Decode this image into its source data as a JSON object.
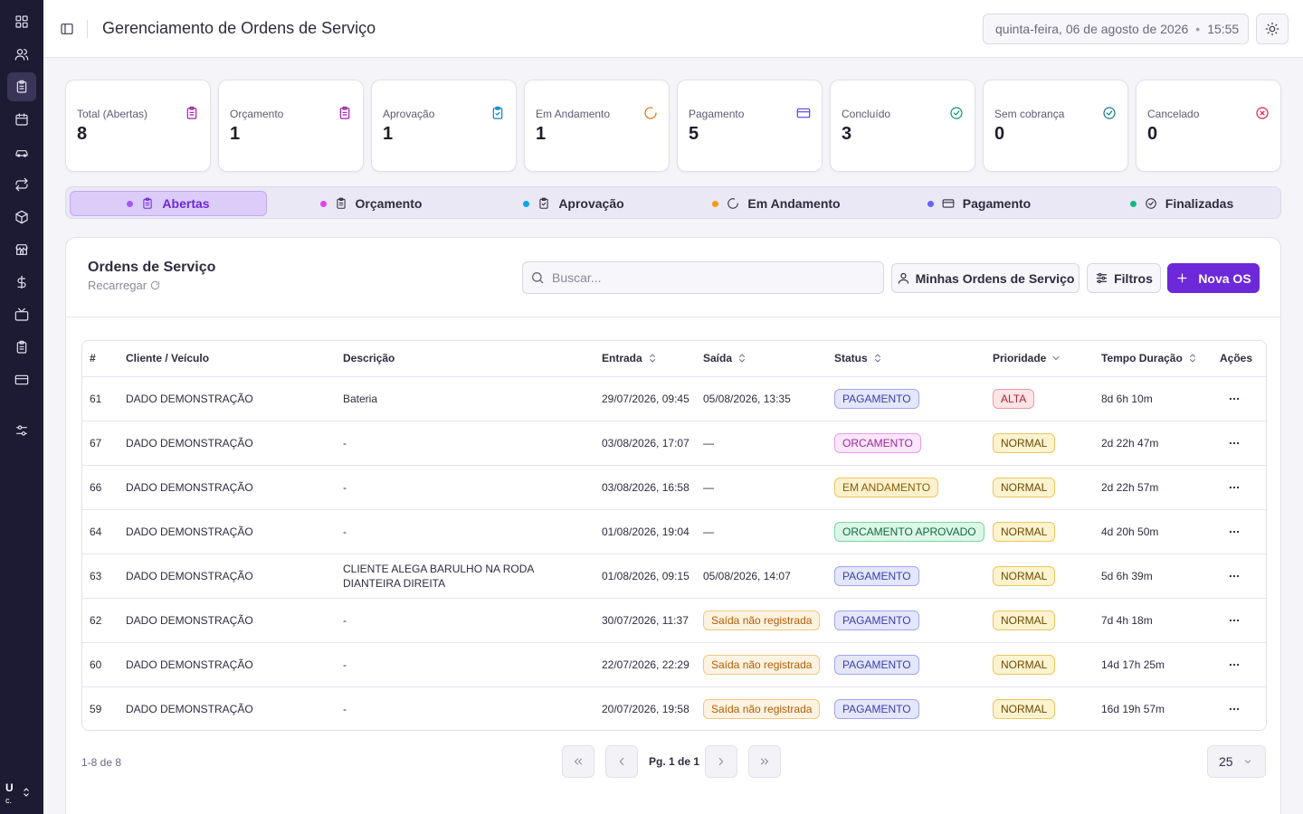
{
  "header": {
    "title": "Gerenciamento de Ordens de Serviço",
    "date": "quinta-feira, 06 de agosto de 2026",
    "separator": "•",
    "time": "15:55"
  },
  "sidebar": {
    "items": [
      {
        "icon": "dashboard-icon"
      },
      {
        "icon": "users-icon"
      },
      {
        "icon": "clipboard-icon",
        "active": true
      },
      {
        "icon": "calendar-icon"
      },
      {
        "icon": "car-icon"
      },
      {
        "icon": "repeat-icon"
      },
      {
        "icon": "package-icon"
      },
      {
        "icon": "store-icon"
      },
      {
        "icon": "dollar-icon"
      },
      {
        "icon": "tv-icon"
      },
      {
        "icon": "clipboard-list-icon"
      },
      {
        "icon": "credit-card-icon"
      },
      {
        "icon": "settings-sliders-icon"
      }
    ],
    "user_initial": "U",
    "user_sub": "c."
  },
  "stats": [
    {
      "label": "Total (Abertas)",
      "value": "8",
      "icon": "clipboard-icon",
      "color": "#a21caf"
    },
    {
      "label": "Orçamento",
      "value": "1",
      "icon": "clipboard-icon",
      "color": "#a21caf"
    },
    {
      "label": "Aprovação",
      "value": "1",
      "icon": "clipboard-check-icon",
      "color": "#0284c7"
    },
    {
      "label": "Em Andamento",
      "value": "1",
      "icon": "loader-icon",
      "color": "#d97706"
    },
    {
      "label": "Pagamento",
      "value": "5",
      "icon": "credit-card-icon",
      "color": "#4f46e5"
    },
    {
      "label": "Concluído",
      "value": "3",
      "icon": "check-circle-icon",
      "color": "#059669"
    },
    {
      "label": "Sem cobrança",
      "value": "0",
      "icon": "check-circle-icon",
      "color": "#0e7490"
    },
    {
      "label": "Cancelado",
      "value": "0",
      "icon": "x-circle-icon",
      "color": "#e11d48"
    }
  ],
  "tabs": [
    {
      "label": "Abertas",
      "dot": "#a855f7",
      "icon": "clipboard-icon",
      "active": true
    },
    {
      "label": "Orçamento",
      "dot": "#d946ef",
      "icon": "clipboard-icon"
    },
    {
      "label": "Aprovação",
      "dot": "#0ea5e9",
      "icon": "clipboard-check-icon"
    },
    {
      "label": "Em Andamento",
      "dot": "#f59e0b",
      "icon": "loader-icon"
    },
    {
      "label": "Pagamento",
      "dot": "#6366f1",
      "icon": "credit-card-icon"
    },
    {
      "label": "Finalizadas",
      "dot": "#10b981",
      "icon": "check-circle-icon"
    }
  ],
  "main": {
    "title": "Ordens de Serviço",
    "reload": "Recarregar",
    "search_placeholder": "Buscar...",
    "my_orders_label": "Minhas Ordens de Serviço",
    "filters_label": "Filtros",
    "new_label": "Nova OS"
  },
  "table": {
    "columns": [
      "#",
      "Cliente / Veículo",
      "Descrição",
      "Entrada",
      "Saída",
      "Status",
      "Prioridade",
      "Tempo Duração",
      "Ações"
    ],
    "rows": [
      {
        "id": "61",
        "client": "DADO DEMONSTRAÇÃO",
        "desc": "Bateria",
        "entrada": "29/07/2026, 09:45",
        "saida": "05/08/2026, 13:35",
        "saida_badge": false,
        "status": "PAGAMENTO",
        "status_kind": "pag",
        "priority": "ALTA",
        "priority_kind": "alta",
        "duration": "8d 6h 10m"
      },
      {
        "id": "67",
        "client": "DADO DEMONSTRAÇÃO",
        "desc": "-",
        "entrada": "03/08/2026, 17:07",
        "saida": "—",
        "saida_badge": false,
        "status": "ORCAMENTO",
        "status_kind": "orc",
        "priority": "NORMAL",
        "priority_kind": "normal",
        "duration": "2d 22h 47m"
      },
      {
        "id": "66",
        "client": "DADO DEMONSTRAÇÃO",
        "desc": "-",
        "entrada": "03/08/2026, 16:58",
        "saida": "—",
        "saida_badge": false,
        "status": "EM ANDAMENTO",
        "status_kind": "and",
        "priority": "NORMAL",
        "priority_kind": "normal",
        "duration": "2d 22h 57m"
      },
      {
        "id": "64",
        "client": "DADO DEMONSTRAÇÃO",
        "desc": "-",
        "entrada": "01/08/2026, 19:04",
        "saida": "—",
        "saida_badge": false,
        "status": "ORCAMENTO APROVADO",
        "status_kind": "apr",
        "priority": "NORMAL",
        "priority_kind": "normal",
        "duration": "4d 20h 50m"
      },
      {
        "id": "63",
        "client": "DADO DEMONSTRAÇÃO",
        "desc": "CLIENTE ALEGA BARULHO NA RODA DIANTEIRA DIREITA",
        "entrada": "01/08/2026, 09:15",
        "saida": "05/08/2026, 14:07",
        "saida_badge": false,
        "status": "PAGAMENTO",
        "status_kind": "pag",
        "priority": "NORMAL",
        "priority_kind": "normal",
        "duration": "5d 6h 39m"
      },
      {
        "id": "62",
        "client": "DADO DEMONSTRAÇÃO",
        "desc": "-",
        "entrada": "30/07/2026, 11:37",
        "saida": "Saída não registrada",
        "saida_badge": true,
        "status": "PAGAMENTO",
        "status_kind": "pag",
        "priority": "NORMAL",
        "priority_kind": "normal",
        "duration": "7d 4h 18m"
      },
      {
        "id": "60",
        "client": "DADO DEMONSTRAÇÃO",
        "desc": "-",
        "entrada": "22/07/2026, 22:29",
        "saida": "Saída não registrada",
        "saida_badge": true,
        "status": "PAGAMENTO",
        "status_kind": "pag",
        "priority": "NORMAL",
        "priority_kind": "normal",
        "duration": "14d 17h 25m"
      },
      {
        "id": "59",
        "client": "DADO DEMONSTRAÇÃO",
        "desc": "-",
        "entrada": "20/07/2026, 19:58",
        "saida": "Saída não registrada",
        "saida_badge": true,
        "status": "PAGAMENTO",
        "status_kind": "pag",
        "priority": "NORMAL",
        "priority_kind": "normal",
        "duration": "16d 19h 57m"
      }
    ]
  },
  "footer": {
    "count": "1-8 de 8",
    "page": "Pg. 1 de 1",
    "per_page": "25"
  }
}
